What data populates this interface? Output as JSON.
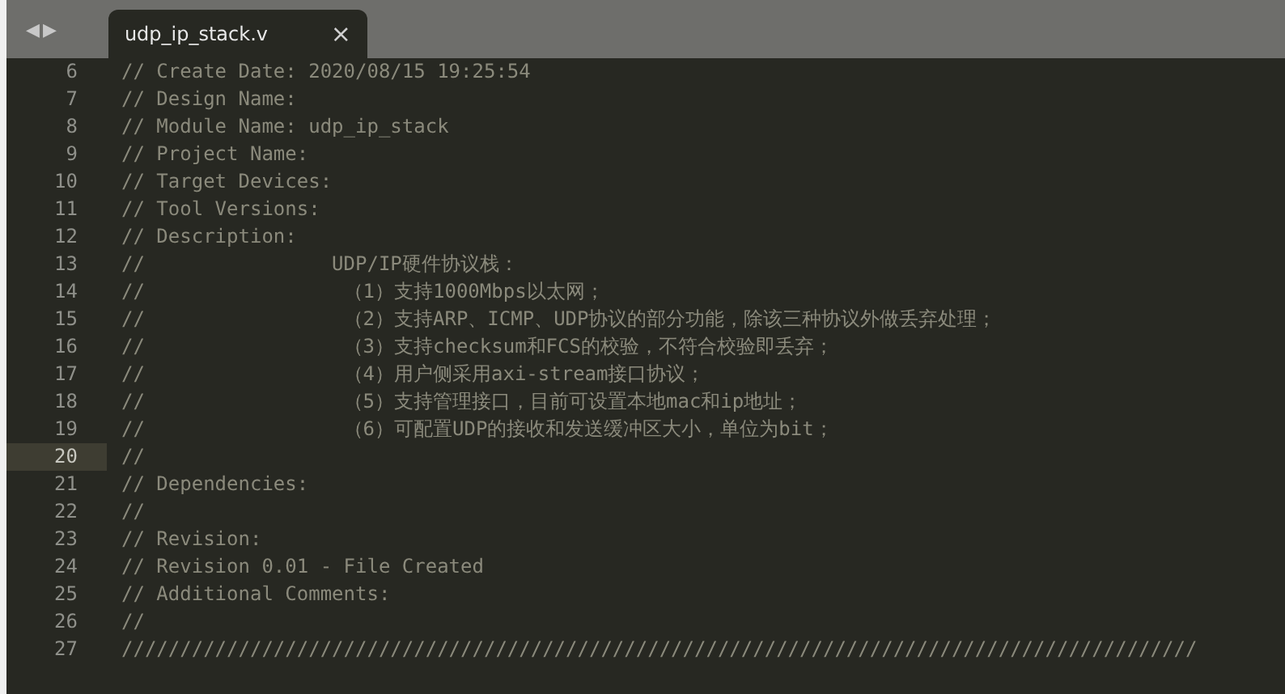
{
  "nav": {
    "back": "◀",
    "forward": "▶"
  },
  "tabs": [
    {
      "label": "udp_ip_stack.v",
      "close": "×",
      "selected": true
    }
  ],
  "lines": [
    {
      "number": "6",
      "text": "// Create Date: 2020/08/15 19:25:54",
      "selected": false
    },
    {
      "number": "7",
      "text": "// Design Name:",
      "selected": false
    },
    {
      "number": "8",
      "text": "// Module Name: udp_ip_stack",
      "selected": false
    },
    {
      "number": "9",
      "text": "// Project Name:",
      "selected": false
    },
    {
      "number": "10",
      "text": "// Target Devices:",
      "selected": false
    },
    {
      "number": "11",
      "text": "// Tool Versions:",
      "selected": false
    },
    {
      "number": "12",
      "text": "// Description:",
      "selected": false
    },
    {
      "number": "13",
      "text": "//                UDP/IP硬件协议栈：",
      "selected": false
    },
    {
      "number": "14",
      "text": "//                 （1）支持1000Mbps以太网；",
      "selected": false
    },
    {
      "number": "15",
      "text": "//                 （2）支持ARP、ICMP、UDP协议的部分功能，除该三种协议外做丢弃处理；",
      "selected": false
    },
    {
      "number": "16",
      "text": "//                 （3）支持checksum和FCS的校验，不符合校验即丢弃；",
      "selected": false
    },
    {
      "number": "17",
      "text": "//                 （4）用户侧采用axi-stream接口协议；",
      "selected": false
    },
    {
      "number": "18",
      "text": "//                 （5）支持管理接口，目前可设置本地mac和ip地址；",
      "selected": false
    },
    {
      "number": "19",
      "text": "//                 （6）可配置UDP的接收和发送缓冲区大小，单位为bit；",
      "selected": false
    },
    {
      "number": "20",
      "text": "//",
      "selected": true
    },
    {
      "number": "21",
      "text": "// Dependencies:",
      "selected": false
    },
    {
      "number": "22",
      "text": "//",
      "selected": false
    },
    {
      "number": "23",
      "text": "// Revision:",
      "selected": false
    },
    {
      "number": "24",
      "text": "// Revision 0.01 - File Created",
      "selected": false
    },
    {
      "number": "25",
      "text": "// Additional Comments:",
      "selected": false
    },
    {
      "number": "26",
      "text": "//",
      "selected": false
    },
    {
      "number": "27",
      "text": "////////////////////////////////////////////////////////////////////////////////////////////",
      "selected": false
    }
  ]
}
